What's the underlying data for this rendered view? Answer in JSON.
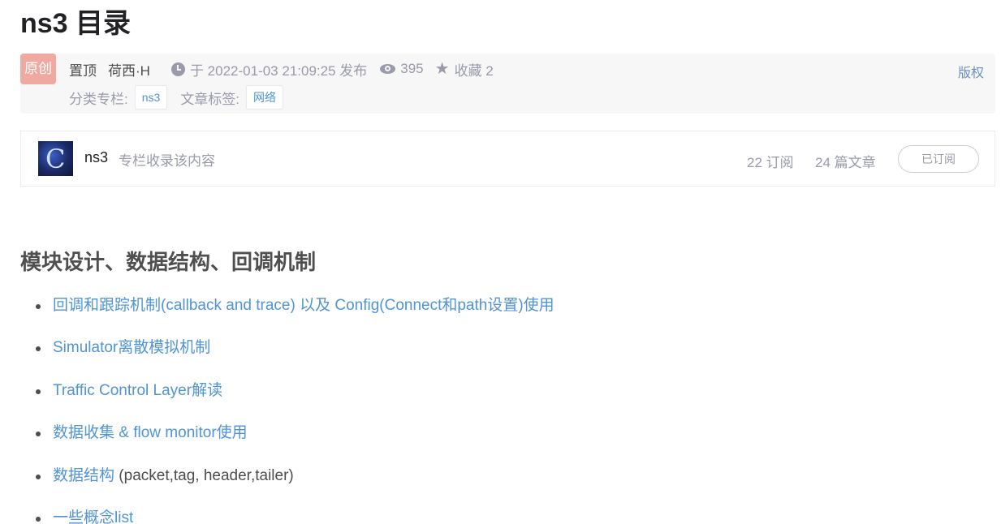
{
  "article": {
    "title": "ns3 目录",
    "original_badge": "原创",
    "pinned": "置顶",
    "author": "荷西·H",
    "published": "于 2022-01-03 21:09:25 发布",
    "views": "395",
    "favorites": "收藏 2",
    "copyright": "版权",
    "category_label": "分类专栏:",
    "category_tag": "ns3",
    "tags_label": "文章标签:",
    "article_tag": "网络"
  },
  "column": {
    "name": "ns3",
    "description": "专栏收录该内容",
    "subscribers": "22 订阅",
    "posts": "24 篇文章",
    "subscribe_button": "已订阅"
  },
  "section": {
    "heading": "模块设计、数据结构、回调机制"
  },
  "toc": [
    {
      "link": "回调和跟踪机制(callback and trace) 以及 Config(Connect和path设置)使用",
      "suffix": ""
    },
    {
      "link": "Simulator离散模拟机制",
      "suffix": ""
    },
    {
      "link": "Traffic Control Layer解读",
      "suffix": ""
    },
    {
      "link": "数据收集 & flow monitor使用",
      "suffix": ""
    },
    {
      "link": "数据结构",
      "suffix": " (packet,tag, header,tailer)"
    },
    {
      "link": "一些概念list",
      "suffix": ""
    }
  ],
  "colors": {
    "link": "#5094d5",
    "badge": "#f0a9a0",
    "meta_background": "#f7f7f8"
  },
  "icons": [
    "clock-icon",
    "eye-icon",
    "star-icon"
  ]
}
